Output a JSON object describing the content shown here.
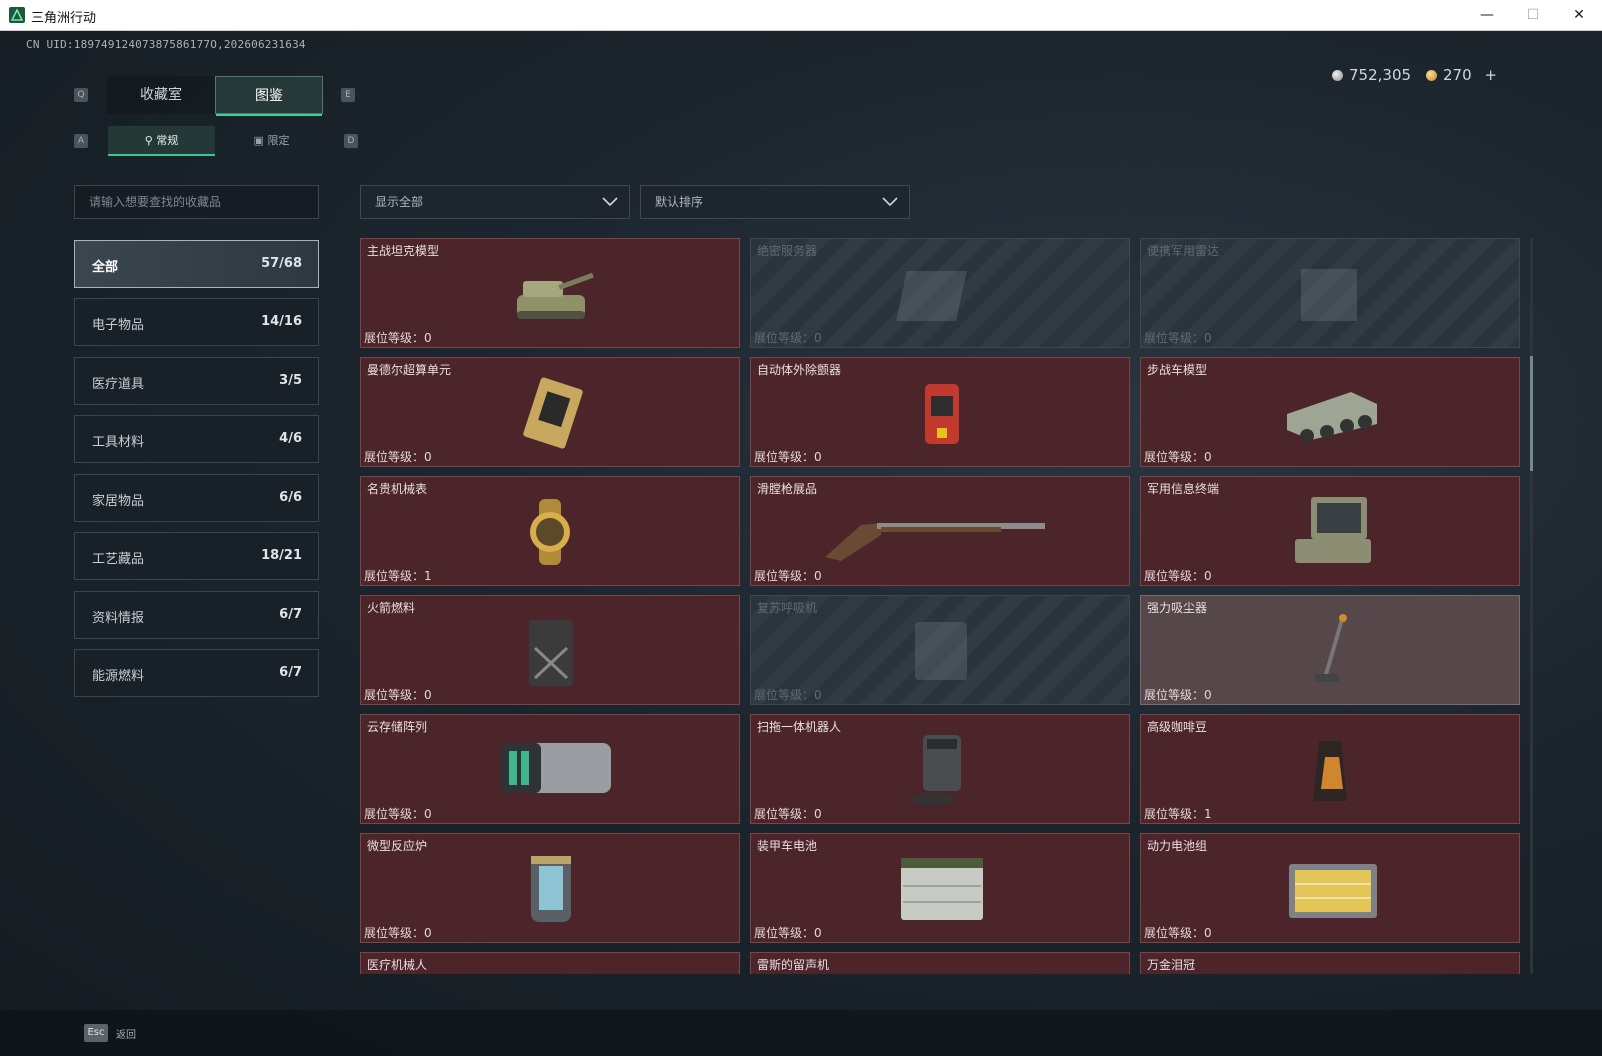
{
  "window": {
    "title": "三角洲行动"
  },
  "uid": "CN UID:18974912407387586177O,202606231634",
  "currency": {
    "silver": "752,305",
    "gold": "270",
    "gold_add": "+"
  },
  "tabs": [
    {
      "label": "收藏室",
      "active": false
    },
    {
      "label": "图鉴",
      "active": true
    }
  ],
  "key_hints": {
    "prev_tab": "Q",
    "next_tab": "E",
    "prev_sub": "A",
    "next_sub": "D"
  },
  "subtabs": [
    {
      "label": "常规",
      "active": true
    },
    {
      "label": "限定",
      "active": false
    }
  ],
  "search": {
    "placeholder": "请输入想要查找的收藏品"
  },
  "filters": {
    "display": "显示全部",
    "sort": "默认排序"
  },
  "categories": [
    {
      "label": "全部",
      "count": "57/68",
      "active": true
    },
    {
      "label": "电子物品",
      "count": "14/16"
    },
    {
      "label": "医疗道具",
      "count": "3/5"
    },
    {
      "label": "工具材料",
      "count": "4/6"
    },
    {
      "label": "家居物品",
      "count": "6/6"
    },
    {
      "label": "工艺藏品",
      "count": "18/21"
    },
    {
      "label": "资料情报",
      "count": "6/7"
    },
    {
      "label": "能源燃料",
      "count": "6/7"
    }
  ],
  "items": [
    {
      "name": "主战坦克模型",
      "level": "展位等级：0",
      "state": "owned",
      "icon": "tank-model-icon"
    },
    {
      "name": "绝密服务器",
      "level": "展位等级：0",
      "state": "locked",
      "icon": "server-icon"
    },
    {
      "name": "便携军用雷达",
      "level": "展位等级：0",
      "state": "locked",
      "icon": "radar-icon"
    },
    {
      "name": "曼德尔超算单元",
      "level": "展位等级：0",
      "state": "owned",
      "icon": "compute-unit-icon"
    },
    {
      "name": "自动体外除颤器",
      "level": "展位等级：0",
      "state": "owned",
      "icon": "defibrillator-icon"
    },
    {
      "name": "步战车模型",
      "level": "展位等级：0",
      "state": "owned",
      "icon": "ifv-model-icon"
    },
    {
      "name": "名贵机械表",
      "level": "展位等级：1",
      "state": "owned",
      "icon": "watch-icon"
    },
    {
      "name": "滑膛枪展品",
      "level": "展位等级：0",
      "state": "owned",
      "icon": "musket-icon"
    },
    {
      "name": "军用信息终端",
      "level": "展位等级：0",
      "state": "owned",
      "icon": "terminal-icon"
    },
    {
      "name": "火箭燃料",
      "level": "展位等级：0",
      "state": "owned",
      "icon": "fuel-can-icon"
    },
    {
      "name": "复苏呼吸机",
      "level": "展位等级：0",
      "state": "locked",
      "icon": "ventilator-icon"
    },
    {
      "name": "强力吸尘器",
      "level": "展位等级：0",
      "state": "dim",
      "icon": "vacuum-icon"
    },
    {
      "name": "云存储阵列",
      "level": "展位等级：0",
      "state": "owned",
      "icon": "storage-array-icon"
    },
    {
      "name": "扫拖一体机器人",
      "level": "展位等级：0",
      "state": "owned",
      "icon": "robot-vacuum-icon"
    },
    {
      "name": "高级咖啡豆",
      "level": "展位等级：1",
      "state": "owned",
      "icon": "coffee-bag-icon"
    },
    {
      "name": "微型反应炉",
      "level": "展位等级：0",
      "state": "owned",
      "icon": "reactor-icon"
    },
    {
      "name": "装甲车电池",
      "level": "展位等级：0",
      "state": "owned",
      "icon": "battery-icon"
    },
    {
      "name": "动力电池组",
      "level": "展位等级：0",
      "state": "owned",
      "icon": "battery-pack-icon"
    },
    {
      "name": "医疗机械人",
      "level": "",
      "state": "owned",
      "icon": "medical-robot-icon"
    },
    {
      "name": "雷斯的留声机",
      "level": "",
      "state": "owned",
      "icon": "gramophone-icon"
    },
    {
      "name": "万金泪冠",
      "level": "",
      "state": "owned",
      "icon": "crown-icon"
    }
  ],
  "footer": {
    "esc_key": "Esc",
    "back_label": "返回"
  },
  "colors": {
    "accent": "#39d29a",
    "card_owned": "#4b2529",
    "card_border": "#7a4448",
    "card_locked": "#2b343c"
  }
}
